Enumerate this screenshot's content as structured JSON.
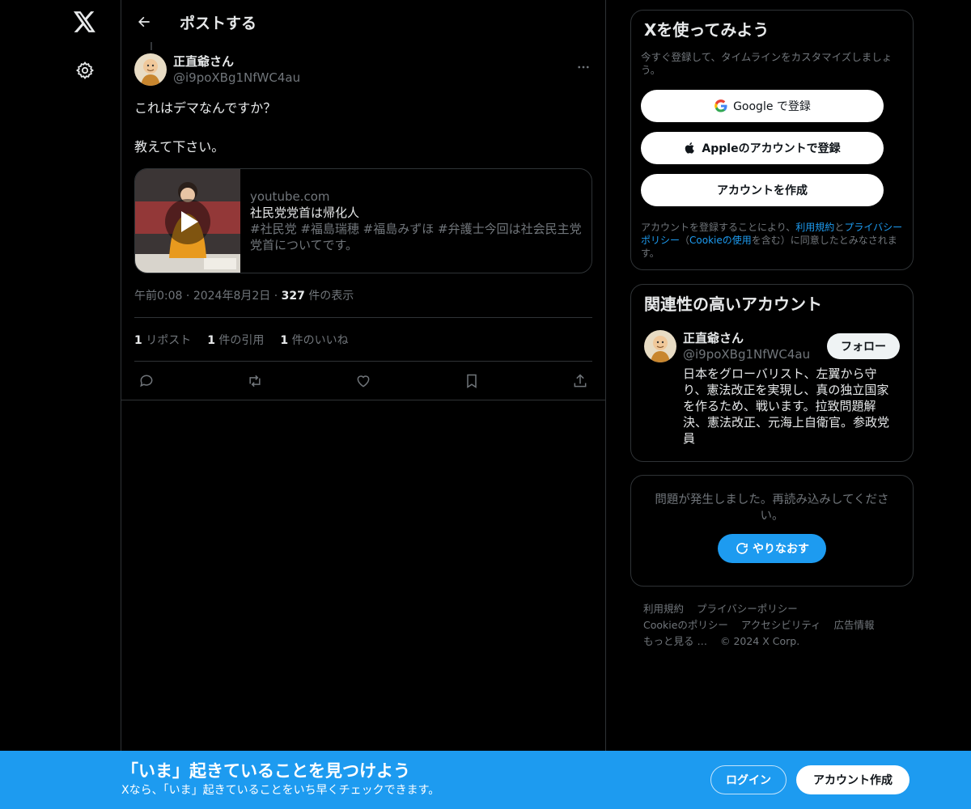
{
  "header": {
    "title": "ポストする"
  },
  "post": {
    "author_name": "正直爺さん",
    "author_handle": "@i9poXBg1NfWC4au",
    "text_lines": [
      "これはデマなんですか？",
      "教えて下さい。"
    ],
    "card": {
      "domain": "youtube.com",
      "title": "社民党党首は帰化人",
      "description": "#社民党 #福島瑞穂 #福島みずほ #弁護士今回は社会民主党党首についてです。"
    },
    "time": "午前0:08",
    "date": "2024年8月2日",
    "views_count": "327",
    "views_label": "件の表示",
    "reposts_count": "1",
    "reposts_label": "リポスト",
    "quotes_count": "1",
    "quotes_label": "件の引用",
    "likes_count": "1",
    "likes_label": "件のいいね"
  },
  "signup": {
    "title": "Xを使ってみよう",
    "subtitle": "今すぐ登録して、タイムラインをカスタマイズしましょう。",
    "google_label": "Google で登録",
    "apple_label": "Appleのアカウントで登録",
    "create_label": "アカウントを作成",
    "legal_prefix": "アカウントを登録することにより、",
    "terms_link": "利用規約",
    "and": "と",
    "privacy_link": "プライバシーポリシー",
    "cookie_open": "（",
    "cookie_link": "Cookieの使用",
    "cookie_close": "を含む）に同意したとみなされます。"
  },
  "relevant": {
    "title": "関連性の高いアカウント",
    "name": "正直爺さん",
    "handle": "@i9poXBg1NfWC4au",
    "bio": "日本をグローバリスト、左翼から守り、憲法改正を実現し、真の独立国家を作るため、戦います。拉致問題解決、憲法改正、元海上自衛官。参政党員",
    "follow_label": "フォロー"
  },
  "error": {
    "message": "問題が発生しました。再読み込みしてください。",
    "retry_label": "やりなおす"
  },
  "footer": {
    "terms": "利用規約",
    "privacy": "プライバシーポリシー",
    "cookie": "Cookieのポリシー",
    "accessibility": "アクセシビリティ",
    "ads": "広告情報",
    "more": "もっと見る …",
    "copyright": "© 2024 X Corp."
  },
  "banner": {
    "title": "「いま」起きていることを見つけよう",
    "subtitle": "Xなら、「いま」起きていることをいち早くチェックできます。",
    "login_label": "ログイン",
    "create_label": "アカウント作成"
  },
  "colors": {
    "accent": "#1d9bf0",
    "background": "#000000",
    "border": "#2f3336",
    "muted_text": "#71767b"
  }
}
